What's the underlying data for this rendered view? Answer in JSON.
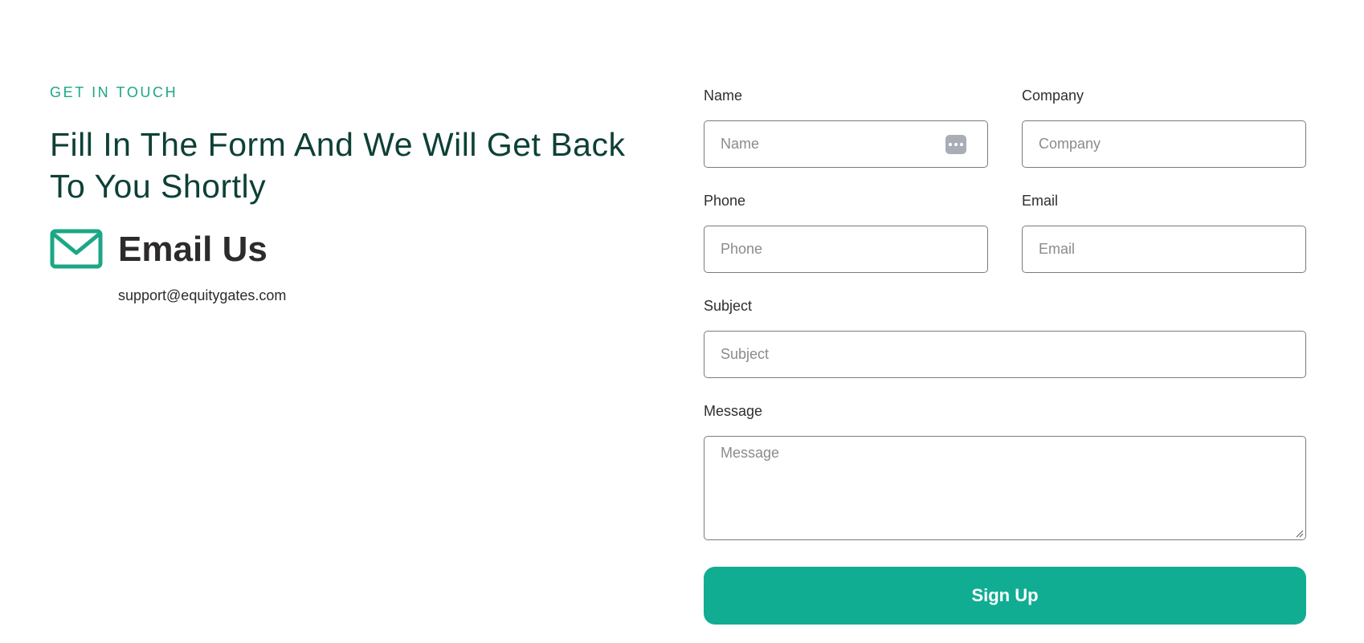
{
  "contact": {
    "eyebrow": "GET IN TOUCH",
    "headline": "Fill In The Form And We Will Get Back To You Shortly",
    "email_title": "Email Us",
    "email_address": "support@equitygates.com",
    "accent_color": "#1ba785",
    "headline_color": "#0e4037"
  },
  "form": {
    "name": {
      "label": "Name",
      "placeholder": "Name"
    },
    "company": {
      "label": "Company",
      "placeholder": "Company"
    },
    "phone": {
      "label": "Phone",
      "placeholder": "Phone"
    },
    "email": {
      "label": "Email",
      "placeholder": "Email"
    },
    "subject": {
      "label": "Subject",
      "placeholder": "Subject"
    },
    "message": {
      "label": "Message",
      "placeholder": "Message"
    },
    "submit_label": "Sign Up",
    "submit_color": "#11ad93"
  },
  "icons": {
    "mail": "envelope-icon",
    "autofill": "password-manager-icon",
    "resize": "resize-grip-icon"
  }
}
